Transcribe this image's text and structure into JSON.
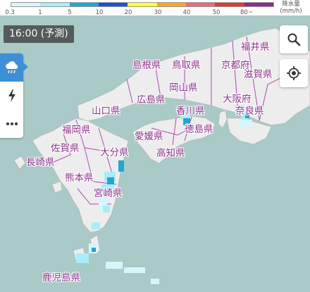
{
  "legend": {
    "colors": [
      "#d7f6fb",
      "#a8eef6",
      "#22a6d6",
      "#1e4fd4",
      "#ffff33",
      "#f6a623",
      "#ee6a77",
      "#e23a2b",
      "#8b2d8c"
    ],
    "ticks": [
      "0.3",
      "1",
      "5",
      "10",
      "20",
      "30",
      "40",
      "50",
      "80~"
    ],
    "unit_title": "降水量",
    "unit": "(mm/h)"
  },
  "time_badge": "16:00 (予測)",
  "side_menu": {
    "items": [
      "rain-cloud-icon",
      "lightning-icon",
      "more-horizontal-icon"
    ]
  },
  "controls": {
    "search": "search-icon",
    "locate": "locate-icon"
  },
  "prefectures": [
    "福井県",
    "島根県",
    "鳥取県",
    "京都府",
    "滋賀県",
    "岡山県",
    "大阪府",
    "山口県",
    "広島県",
    "香川県",
    "奈良県",
    "福岡県",
    "愛媛県",
    "徳島県",
    "佐賀県",
    "大分県",
    "高知県",
    "長崎県",
    "熊本県",
    "宮崎県",
    "鹿児島県"
  ],
  "colors": {
    "sea": "#a9cac6",
    "land": "#eeeeee",
    "border": "#b04ab0",
    "accent": "#3d8fd6"
  }
}
